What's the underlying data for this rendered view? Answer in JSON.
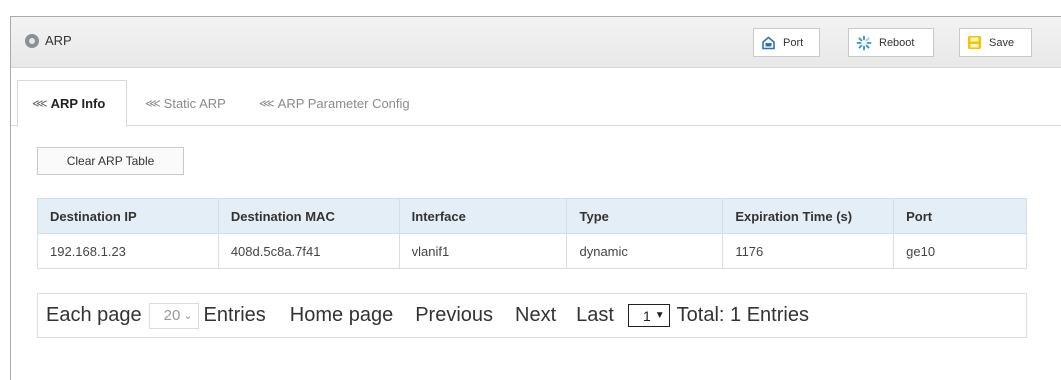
{
  "header": {
    "title": "ARP",
    "buttons": {
      "port": "Port",
      "reboot": "Reboot",
      "save": "Save"
    }
  },
  "tabs": [
    {
      "label": "ARP Info",
      "active": true
    },
    {
      "label": "Static ARP",
      "active": false
    },
    {
      "label": "ARP Parameter Config",
      "active": false
    }
  ],
  "clear_button": "Clear ARP Table",
  "table": {
    "columns": [
      "Destination IP",
      "Destination MAC",
      "Interface",
      "Type",
      "Expiration Time (s)",
      "Port"
    ],
    "rows": [
      [
        "192.168.1.23",
        "408d.5c8a.7f41",
        "vlanif1",
        "dynamic",
        "1176",
        "ge10"
      ]
    ]
  },
  "pager": {
    "each_page_label": "Each page",
    "per_page_value": "20",
    "entries_label": "Entries",
    "home": "Home page",
    "previous": "Previous",
    "next": "Next",
    "last": "Last",
    "current_page": "1",
    "total": "Total: 1 Entries"
  },
  "icons": {
    "title": "circle-icon",
    "port": "port-icon",
    "reboot": "reboot-icon",
    "save": "save-icon",
    "tab": "chevron-right-icon"
  },
  "colors": {
    "table_header_bg": "#e4eef6",
    "save_icon": "#f5c400",
    "port_icon": "#2f6fb5",
    "reboot_icon": "#2f8fd8"
  }
}
